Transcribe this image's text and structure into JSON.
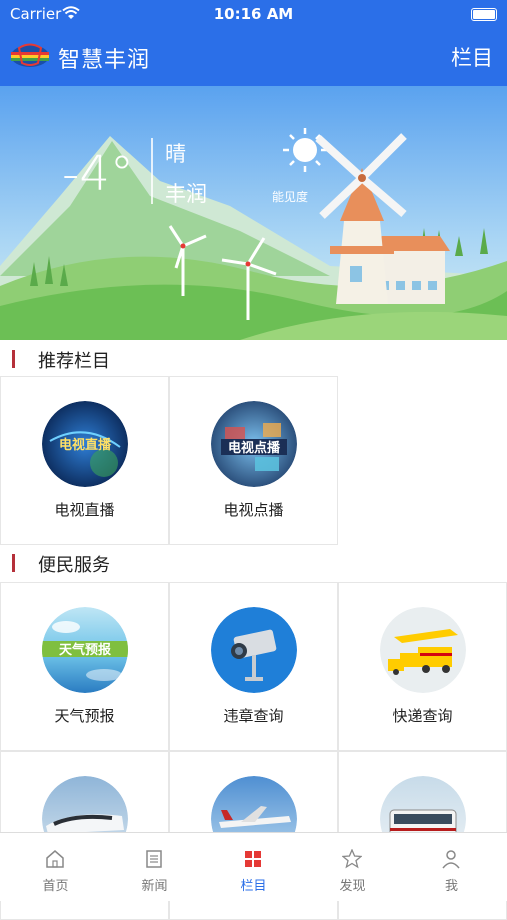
{
  "status": {
    "carrier": "Carrier",
    "time": "10:16 AM"
  },
  "header": {
    "title": "智慧丰润",
    "menu_label": "栏目"
  },
  "weather": {
    "temperature": "-4°",
    "condition": "晴",
    "city": "丰润",
    "visibility_label": "能见度"
  },
  "recommended": {
    "title": "推荐栏目",
    "items": [
      {
        "label": "电视直播",
        "icon_text": "电视直播",
        "icon": "tv-live-icon"
      },
      {
        "label": "电视点播",
        "icon_text": "电视点播",
        "icon": "tv-vod-icon"
      }
    ]
  },
  "services": {
    "title": "便民服务",
    "items": [
      {
        "label": "天气预报",
        "icon_text": "天气预报",
        "icon": "weather-forecast-icon"
      },
      {
        "label": "违章查询",
        "icon": "traffic-camera-icon"
      },
      {
        "label": "快递查询",
        "icon": "express-truck-icon"
      },
      {
        "label": "",
        "icon": "train-icon"
      },
      {
        "label": "",
        "icon": "airplane-icon"
      },
      {
        "label": "",
        "icon": "bus-icon"
      }
    ]
  },
  "tabs": [
    {
      "label": "首页",
      "icon": "home-icon",
      "active": false
    },
    {
      "label": "新闻",
      "icon": "news-icon",
      "active": false
    },
    {
      "label": "栏目",
      "icon": "grid-icon",
      "active": true
    },
    {
      "label": "发现",
      "icon": "discover-icon",
      "active": false
    },
    {
      "label": "我",
      "icon": "profile-icon",
      "active": false
    }
  ],
  "colors": {
    "primary": "#2b6fe8",
    "section_marker": "#b5303a",
    "active_tab": "#2b6fe8"
  }
}
